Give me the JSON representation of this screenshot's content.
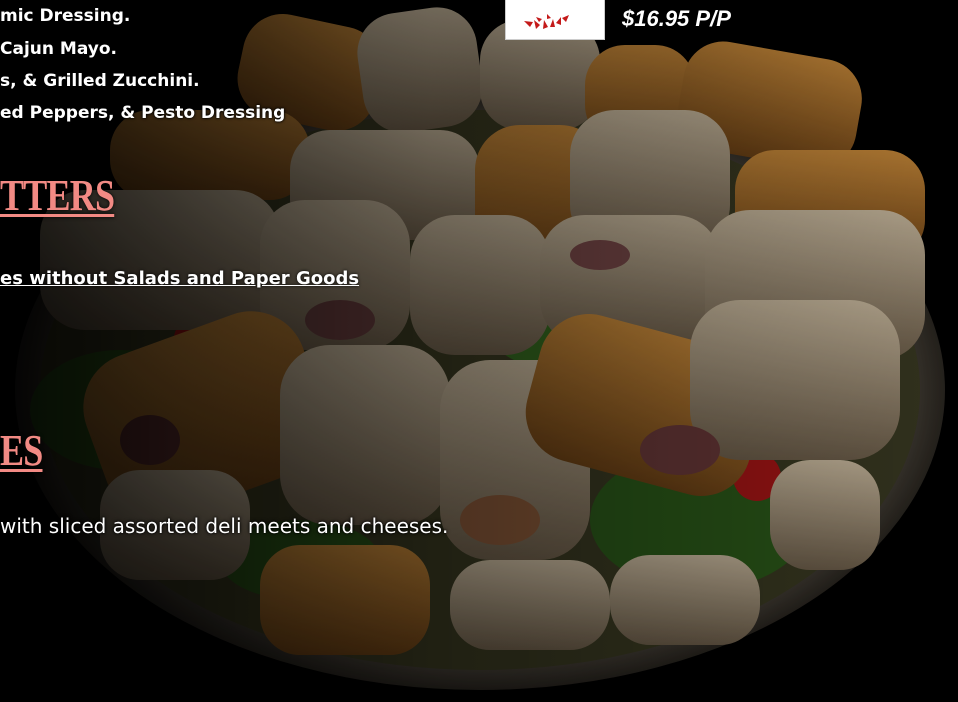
{
  "menu": {
    "wrap_lines": [
      "mic Dressing.",
      "Cajun Mayo.",
      "s, & Grilled Zucchini.",
      "ed Peppers, & Pesto Dressing"
    ],
    "price": "$16.95 P/P",
    "platters_heading": "TTERS",
    "platters_note": "es without Salads and Paper Goods",
    "sandwiches_heading": "ES",
    "sandwiches_desc": "with sliced  assorted deli meets and cheeses."
  },
  "colors": {
    "heading": "#f28a84",
    "background": "#000000",
    "text": "#ffffff"
  },
  "icons": {
    "logo": "red-leaf-logo-icon"
  }
}
